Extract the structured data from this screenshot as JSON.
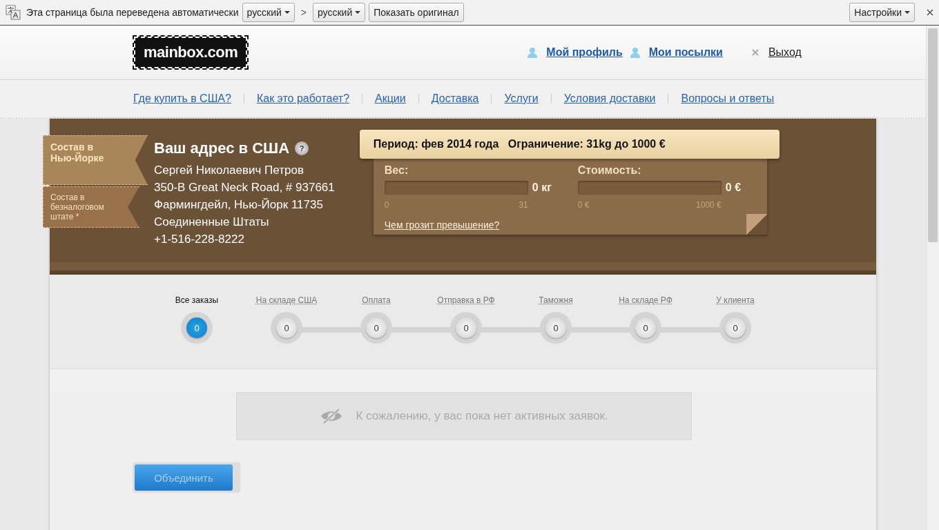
{
  "translate_bar": {
    "message": "Эта страница была переведена автоматически",
    "from_language": "русский",
    "separator": ">",
    "to_language": "русский",
    "show_original": "Показать оригинал",
    "settings": "Настройки"
  },
  "header": {
    "logo": "mainbox.com",
    "profile": "Мой профиль",
    "parcels": "Мои посылки",
    "logout": "Выход"
  },
  "nav": [
    "Где купить в США?",
    "Как это работает?",
    "Акции",
    "Доставка",
    "Услуги",
    "Условия доставки",
    "Вопросы и ответы"
  ],
  "ribbons": [
    {
      "label": "Состав в Нью-Йорке",
      "selected": true
    },
    {
      "label": "Состав в безналоговом штате *",
      "selected": false
    }
  ],
  "address": {
    "title": "Ваш адрес в США",
    "help": "?",
    "lines": [
      "Сергей Николаевич Петров",
      "350-B Great Neck Road, # 937661",
      "Фармингдейл, Нью-Йорк 11735",
      "Соединенные Штаты",
      "+1-516-228-8222"
    ]
  },
  "limits": {
    "period": "Период: фев 2014 года   Ограничение: 31kg до 1000 €",
    "gauges": [
      {
        "label": "Вес:",
        "reading": "0 кг",
        "level": 0,
        "min": "0",
        "max": "31"
      },
      {
        "label": "Стоимость:",
        "reading": "0 €",
        "level": 0,
        "min": "0 €",
        "max": "1000 €"
      }
    ],
    "link": "Чем грозит превышение?"
  },
  "statuses": [
    {
      "label": "Все заказы",
      "count": "0",
      "selected": true
    },
    {
      "label": "На складе США",
      "count": "0",
      "selected": false
    },
    {
      "label": "Оплата",
      "count": "0",
      "selected": false
    },
    {
      "label": "Отправка в РФ",
      "count": "0",
      "selected": false
    },
    {
      "label": "Таможня",
      "count": "0",
      "selected": false
    },
    {
      "label": "На складе РФ",
      "count": "0",
      "selected": false
    },
    {
      "label": "У клиента",
      "count": "0",
      "selected": false
    }
  ],
  "empty_message": "К сожалению, у вас пока нет активных заявок.",
  "merge_button": "Объединить"
}
